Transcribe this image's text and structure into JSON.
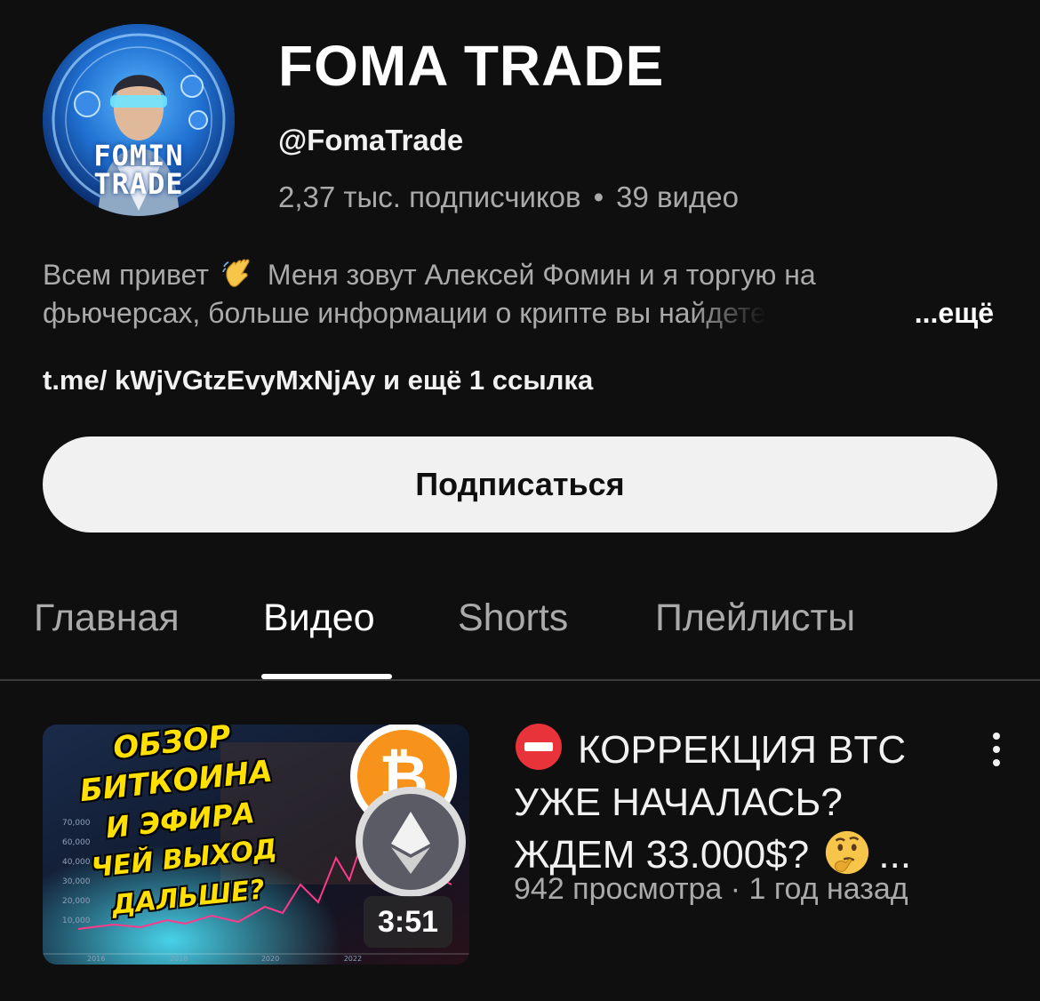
{
  "channel": {
    "name": "FOMA TRADE",
    "handle": "@FomaTrade",
    "subscribers": "2,37 тыс. подписчиков",
    "separator": "•",
    "video_count": "39 видео",
    "avatar_text": [
      "FOMIN",
      "TRADE"
    ],
    "description_line1_a": "Всем привет",
    "description_line1_b": "Меня зовут Алексей Фомин и я торгую на",
    "description_line2": "фьючерсах, больше информации о крипте вы",
    "description_line2_faded": "найдете",
    "more_label": "...ещё",
    "links": "t.me/ kWjVGtzEvyMxNjAy и ещё 1 ссылка"
  },
  "subscribe": {
    "label": "Подписаться"
  },
  "tabs": [
    {
      "label": "Главная",
      "active": false
    },
    {
      "label": "Видео",
      "active": true
    },
    {
      "label": "Shorts",
      "active": false
    },
    {
      "label": "Плейлисты",
      "active": false
    }
  ],
  "video": {
    "title_line1": "КОРРЕКЦИЯ BTC",
    "title_line2": "УЖЕ НАЧАЛАСЬ?",
    "title_line3": "ЖДЕМ 33.000$?",
    "title_ellipsis": "...",
    "meta": "942 просмотра · 1 год назад",
    "duration": "3:51",
    "thumbnail_text": [
      "ОБЗОР БИТКОИНА",
      "И ЭФИРА",
      "ЧЕЙ ВЫХОД ДАЛЬШЕ?"
    ],
    "thumbnail_axis": [
      "70,000",
      "60,000",
      "40,000",
      "30,000",
      "20,000",
      "10,000",
      "2016",
      "2018",
      "2020",
      "2022"
    ],
    "icons": [
      "no-entry-icon",
      "thinking-face-icon",
      "bitcoin-icon",
      "ethereum-icon",
      "more-vertical-icon"
    ]
  },
  "colors": {
    "background": "#0f0f0f",
    "text_primary": "#f1f1f1",
    "text_secondary": "#aaaaaa",
    "subscribe_bg": "#f1f1f1",
    "bitcoin_orange": "#f7931a",
    "thumb_yellow": "#ffe000"
  }
}
